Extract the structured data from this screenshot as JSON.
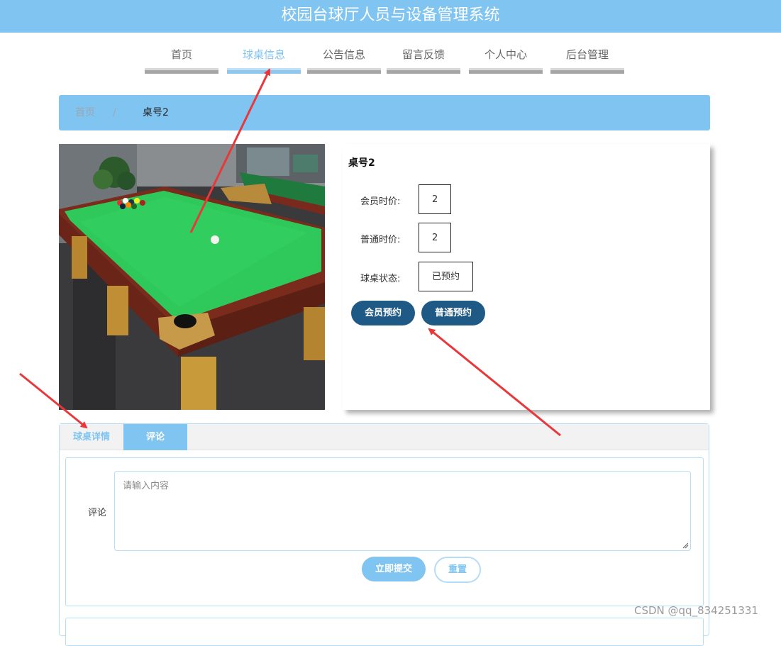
{
  "header": {
    "title": "校园台球厅人员与设备管理系统"
  },
  "nav": {
    "items": [
      {
        "label": "首页",
        "active": false
      },
      {
        "label": "球桌信息",
        "active": true
      },
      {
        "label": "公告信息",
        "active": false
      },
      {
        "label": "留言反馈",
        "active": false
      },
      {
        "label": "个人中心",
        "active": false
      },
      {
        "label": "后台管理",
        "active": false
      }
    ]
  },
  "breadcrumb": {
    "home": "首页",
    "separator": "/",
    "current": "桌号2"
  },
  "detail": {
    "title": "桌号2",
    "fields": [
      {
        "label": "会员时价:",
        "value": "2"
      },
      {
        "label": "普通时价:",
        "value": "2"
      },
      {
        "label": "球桌状态:",
        "value": "已预约"
      }
    ],
    "buttons": {
      "member_booking": "会员预约",
      "regular_booking": "普通预约"
    }
  },
  "tabs": [
    {
      "label": "球桌详情",
      "active": false
    },
    {
      "label": "评论",
      "active": true
    }
  ],
  "comment_form": {
    "label": "评论",
    "placeholder": "请输入内容",
    "value": "",
    "submit_label": "立即提交",
    "reset_label": "重置"
  },
  "watermark": "CSDN @qq_834251331",
  "colors": {
    "primary": "#80c4f1",
    "dark_button": "#1f5a86",
    "annotation_arrow": "#e8383b",
    "table_felt": "#2ec95a"
  }
}
